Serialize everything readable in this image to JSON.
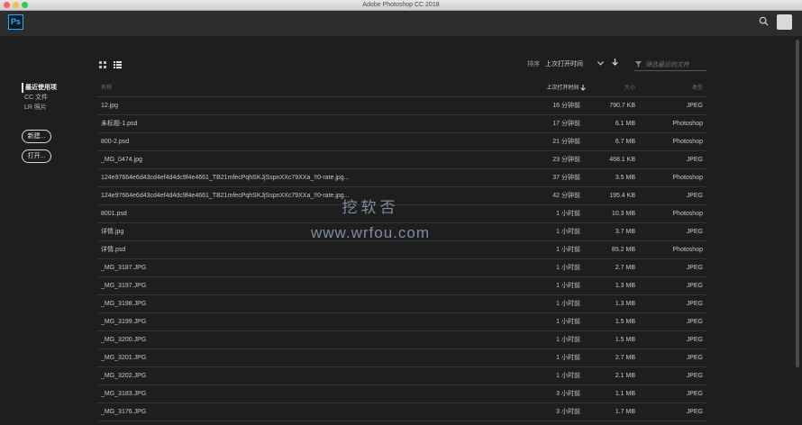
{
  "window": {
    "title": "Adobe Photoshop CC 2018"
  },
  "app": {
    "logo_text": "Ps"
  },
  "sidebar": {
    "items": [
      {
        "label": "最近使用项",
        "active": true
      },
      {
        "label": "CC 文件",
        "active": false
      },
      {
        "label": "LR 照片",
        "active": false
      }
    ],
    "new_button": "新建...",
    "open_button": "打开..."
  },
  "toolbar": {
    "sort_label": "排序",
    "sort_value": "上次打开时间",
    "filter_placeholder": "筛选最近的文件"
  },
  "table": {
    "headers": {
      "name": "名称",
      "time": "上次打开时间",
      "size": "大小",
      "type": "类型"
    },
    "rows": [
      {
        "name": "12.jpg",
        "time": "16 分钟前",
        "size": "790.7 KB",
        "type": "JPEG"
      },
      {
        "name": "未标题-1.psd",
        "time": "17 分钟前",
        "size": "6.1 MB",
        "type": "Photoshop"
      },
      {
        "name": "800-2.psd",
        "time": "21 分钟前",
        "size": "6.7 MB",
        "type": "Photoshop"
      },
      {
        "name": "_MG_0474.jpg",
        "time": "23 分钟前",
        "size": "468.1 KB",
        "type": "JPEG"
      },
      {
        "name": "124e97664e6d43cd4ef4d4dc9f4e4661_TB21mfecPqhSKJjSspnXXc79XXa_!!0-rate.jpg...",
        "time": "37 分钟前",
        "size": "3.5 MB",
        "type": "Photoshop"
      },
      {
        "name": "124e97664e6d43cd4ef4d4dc9f4e4661_TB21mfecPqhSKJjSspnXXc79XXa_!!0-rate.jpg...",
        "time": "42 分钟前",
        "size": "195.4 KB",
        "type": "JPEG"
      },
      {
        "name": "8001.psd",
        "time": "1 小时前",
        "size": "10.3 MB",
        "type": "Photoshop"
      },
      {
        "name": "详情.jpg",
        "time": "1 小时前",
        "size": "3.7 MB",
        "type": "JPEG"
      },
      {
        "name": "详情.psd",
        "time": "1 小时前",
        "size": "85.2 MB",
        "type": "Photoshop"
      },
      {
        "name": "_MG_3187.JPG",
        "time": "1 小时前",
        "size": "2.7 MB",
        "type": "JPEG"
      },
      {
        "name": "_MG_3197.JPG",
        "time": "1 小时前",
        "size": "1.3 MB",
        "type": "JPEG"
      },
      {
        "name": "_MG_3198.JPG",
        "time": "1 小时前",
        "size": "1.3 MB",
        "type": "JPEG"
      },
      {
        "name": "_MG_3199.JPG",
        "time": "1 小时前",
        "size": "1.5 MB",
        "type": "JPEG"
      },
      {
        "name": "_MG_3200.JPG",
        "time": "1 小时前",
        "size": "1.5 MB",
        "type": "JPEG"
      },
      {
        "name": "_MG_3201.JPG",
        "time": "1 小时前",
        "size": "2.7 MB",
        "type": "JPEG"
      },
      {
        "name": "_MG_3202.JPG",
        "time": "1 小时前",
        "size": "2.1 MB",
        "type": "JPEG"
      },
      {
        "name": "_MG_3183.JPG",
        "time": "3 小时前",
        "size": "1.1 MB",
        "type": "JPEG"
      },
      {
        "name": "_MG_3176.JPG",
        "time": "3 小时前",
        "size": "1.7 MB",
        "type": "JPEG"
      }
    ]
  },
  "watermark": {
    "line1": "挖软否",
    "line2": "www.wrfou.com"
  },
  "icons": {
    "search": "search-icon",
    "grid_view": "grid-view-icon",
    "list_view": "list-view-icon",
    "dropdown": "chevron-down-icon",
    "sort_direction": "arrow-down-icon",
    "filter": "filter-icon"
  },
  "colors": {
    "accent": "#31a8ff",
    "background": "#1e1e1e",
    "header": "#2d2d2d"
  }
}
